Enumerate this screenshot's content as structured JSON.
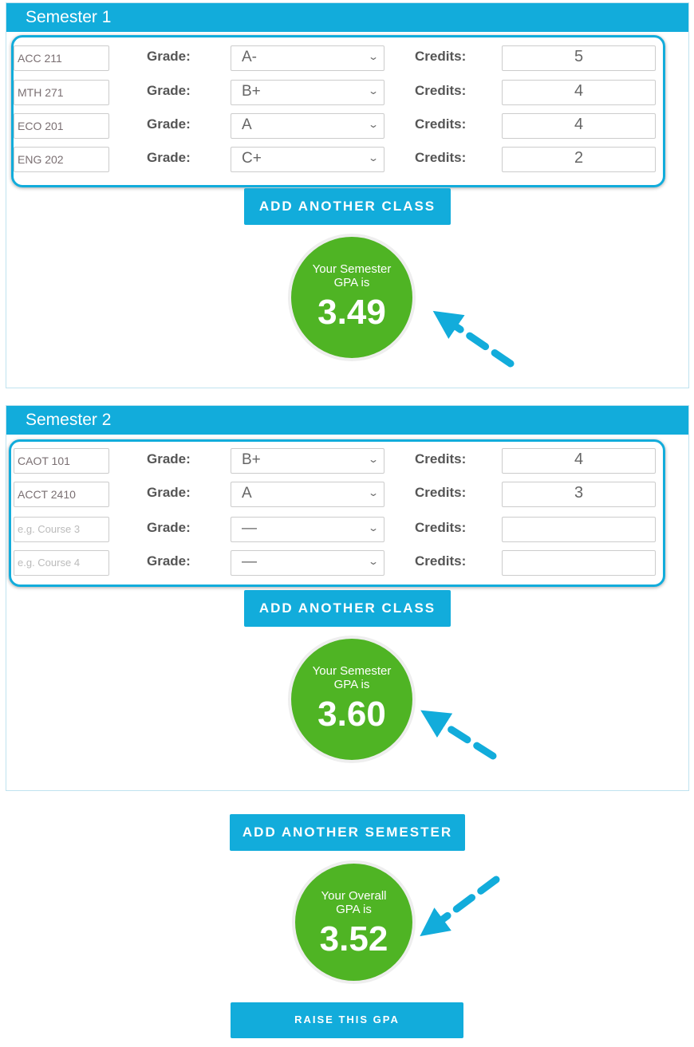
{
  "colors": {
    "accent": "#12acdb",
    "gpa_circle": "#4fb424"
  },
  "labels": {
    "grade": "Grade:",
    "credits": "Credits:"
  },
  "semesters": [
    {
      "title": "Semester 1",
      "add_class_label": "ADD ANOTHER CLASS",
      "gpa_label": "Your Semester GPA is",
      "gpa": "3.49",
      "rows": [
        {
          "course": "ACC 211",
          "placeholder": "",
          "grade": "A-",
          "credits": "5"
        },
        {
          "course": "MTH 271",
          "placeholder": "",
          "grade": "B+",
          "credits": "4"
        },
        {
          "course": "ECO 201",
          "placeholder": "",
          "grade": "A",
          "credits": "4"
        },
        {
          "course": "ENG 202",
          "placeholder": "",
          "grade": "C+",
          "credits": "2"
        }
      ]
    },
    {
      "title": "Semester 2",
      "add_class_label": "ADD ANOTHER CLASS",
      "gpa_label": "Your Semester GPA is",
      "gpa": "3.60",
      "rows": [
        {
          "course": "CAOT 101",
          "placeholder": "",
          "grade": "B+",
          "credits": "4"
        },
        {
          "course": "ACCT 2410",
          "placeholder": "",
          "grade": "A",
          "credits": "3"
        },
        {
          "course": "",
          "placeholder": "e.g. Course 3",
          "grade": "—",
          "credits": ""
        },
        {
          "course": "",
          "placeholder": "e.g. Course 4",
          "grade": "—",
          "credits": ""
        }
      ]
    }
  ],
  "add_semester_label": "ADD ANOTHER SEMESTER",
  "overall": {
    "gpa_label": "Your Overall GPA is",
    "gpa": "3.52"
  },
  "raise_label": "RAISE THIS GPA"
}
